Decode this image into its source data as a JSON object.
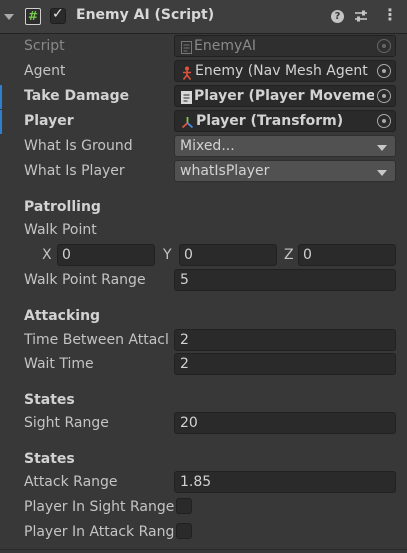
{
  "component": {
    "title": "Enemy AI (Script)",
    "script_icon_glyph": "#",
    "enabled_check_glyph": "✓",
    "help_glyph": "?",
    "more_glyph": "⋮",
    "icons": [
      "script-icon",
      "checkbox-check-icon",
      "help-icon",
      "preset-sliders-icon",
      "more-icon"
    ]
  },
  "fields": {
    "script": {
      "label": "Script",
      "value": "EnemyAI"
    },
    "agent": {
      "label": "Agent",
      "value": "Enemy (Nav Mesh Agent"
    },
    "take_damage": {
      "label": "Take Damage",
      "value": "Player (Player Movemer"
    },
    "player": {
      "label": "Player",
      "value": "Player (Transform)"
    },
    "what_is_ground": {
      "label": "What Is Ground",
      "value": "Mixed..."
    },
    "what_is_player": {
      "label": "What Is Player",
      "value": "whatIsPlayer"
    }
  },
  "patrolling": {
    "header": "Patrolling",
    "walk_point_label": "Walk Point",
    "x_label": "X",
    "x": "0",
    "y_label": "Y",
    "y": "0",
    "z_label": "Z",
    "z": "0",
    "walk_point_range_label": "Walk Point Range",
    "walk_point_range": "5"
  },
  "attacking": {
    "header": "Attacking",
    "time_between_attacks_label": "Time Between Attacl",
    "time_between_attacks": "2",
    "wait_time_label": "Wait Time",
    "wait_time": "2"
  },
  "states1": {
    "header": "States",
    "sight_range_label": "Sight Range",
    "sight_range": "20"
  },
  "states2": {
    "header": "States",
    "attack_range_label": "Attack Range",
    "attack_range": "1.85",
    "player_in_sight_label": "Player In Sight Range",
    "player_in_sight": false,
    "player_in_attack_label": "Player In Attack Rang",
    "player_in_attack": false
  },
  "colors": {
    "modified_marker": "#2f7fce",
    "panel_bg": "#383838",
    "field_bg": "#2a2a2a"
  }
}
